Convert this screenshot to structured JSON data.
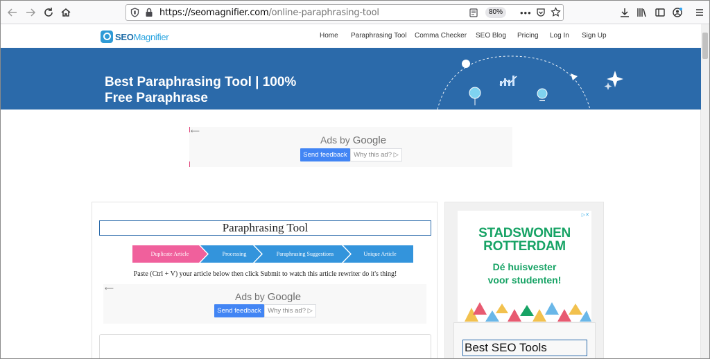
{
  "browser": {
    "url_host": "https://seomagnifier.com",
    "url_path": "/online-paraphrasing-tool",
    "zoom": "80%"
  },
  "site": {
    "logo_seo": "SEO",
    "logo_magnifier": "Magnifier",
    "nav": [
      "Home",
      "Paraphrasing Tool",
      "Comma Checker",
      "SEO Blog",
      "Pricing",
      "Log In",
      "Sign Up"
    ]
  },
  "hero": {
    "title_line1": "Best Paraphrasing Tool | 100%",
    "title_line2": "Free Paraphrase"
  },
  "ad_top": {
    "ads_by": "Ads by",
    "google": "Google",
    "feedback": "Send feedback",
    "why": "Why this ad? ▷"
  },
  "tool": {
    "title": "Paraphrasing Tool",
    "steps": [
      "Duplicate Article",
      "Processing",
      "Paraphrasing Suggestions",
      "Unique Article"
    ],
    "instructions": "Paste (Ctrl + V) your article below then click Submit to watch this article rewriter do it's thing!"
  },
  "ad_inline": {
    "ads_by": "Ads by",
    "google": "Google",
    "feedback": "Send feedback",
    "why": "Why this ad? ▷"
  },
  "sidebar": {
    "promo_line1": "STADSWONEN",
    "promo_line2": "ROTTERDAM",
    "promo_line3": "Dé huisvester",
    "promo_line4": "voor studenten!",
    "tools_title": "Best SEO Tools"
  },
  "colors": {
    "hero_bg": "#2b6aaa",
    "step_active": "#f0609c",
    "step": "#3394dc",
    "promo_green": "#17a365"
  }
}
